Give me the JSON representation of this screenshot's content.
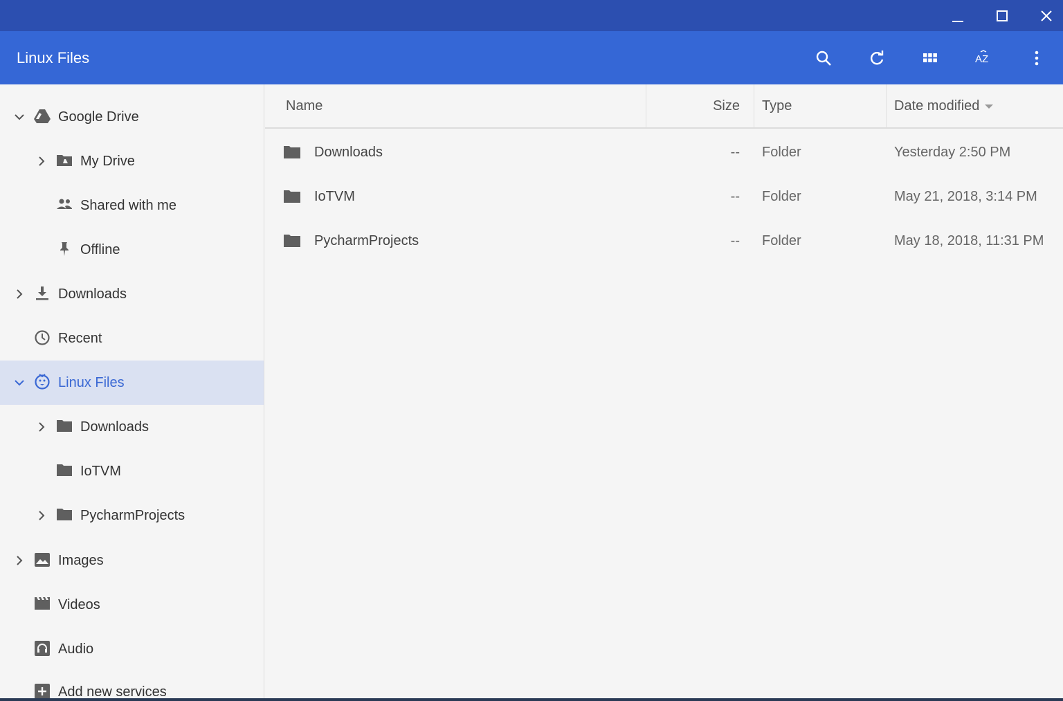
{
  "window": {
    "minimize_icon": "minimize-icon",
    "maximize_icon": "maximize-icon",
    "close_icon": "close-icon"
  },
  "appbar": {
    "title": "Linux Files",
    "tools": [
      "search-icon",
      "refresh-icon",
      "grid-view-icon",
      "sort-az-icon",
      "more-vert-icon"
    ]
  },
  "sidebar": {
    "items": [
      {
        "label": "Google Drive",
        "icon": "google-drive-icon",
        "expand": "expanded"
      },
      {
        "label": "My Drive",
        "icon": "my-drive-icon",
        "expand": "collapsed"
      },
      {
        "label": "Shared with me",
        "icon": "people-icon",
        "expand": "none"
      },
      {
        "label": "Offline",
        "icon": "pin-icon",
        "expand": "none"
      },
      {
        "label": "Downloads",
        "icon": "download-icon",
        "expand": "collapsed"
      },
      {
        "label": "Recent",
        "icon": "clock-icon",
        "expand": "none"
      },
      {
        "label": "Linux Files",
        "icon": "linux-penguin-icon",
        "expand": "expanded",
        "selected": true
      },
      {
        "label": "Downloads",
        "icon": "folder-icon",
        "expand": "collapsed"
      },
      {
        "label": "IoTVM",
        "icon": "folder-icon",
        "expand": "none"
      },
      {
        "label": "PycharmProjects",
        "icon": "folder-icon",
        "expand": "collapsed"
      },
      {
        "label": "Images",
        "icon": "image-icon",
        "expand": "collapsed"
      },
      {
        "label": "Videos",
        "icon": "video-icon",
        "expand": "none"
      },
      {
        "label": "Audio",
        "icon": "headphones-icon",
        "expand": "none"
      },
      {
        "label": "Add new services",
        "icon": "add-box-icon",
        "expand": "none"
      }
    ]
  },
  "table": {
    "headers": {
      "name": "Name",
      "size": "Size",
      "type": "Type",
      "date": "Date modified"
    },
    "rows": [
      {
        "name": "Downloads",
        "size": "--",
        "type": "Folder",
        "date": "Yesterday 2:50 PM"
      },
      {
        "name": "IoTVM",
        "size": "--",
        "type": "Folder",
        "date": "May 21, 2018, 3:14 PM"
      },
      {
        "name": "PycharmProjects",
        "size": "--",
        "type": "Folder",
        "date": "May 18, 2018, 11:31 PM"
      }
    ]
  },
  "colors": {
    "titlebar": "#2c4fb0",
    "appbar": "#3567d6",
    "selected_bg": "#dae1f2",
    "selected_text": "#3a68d4"
  }
}
